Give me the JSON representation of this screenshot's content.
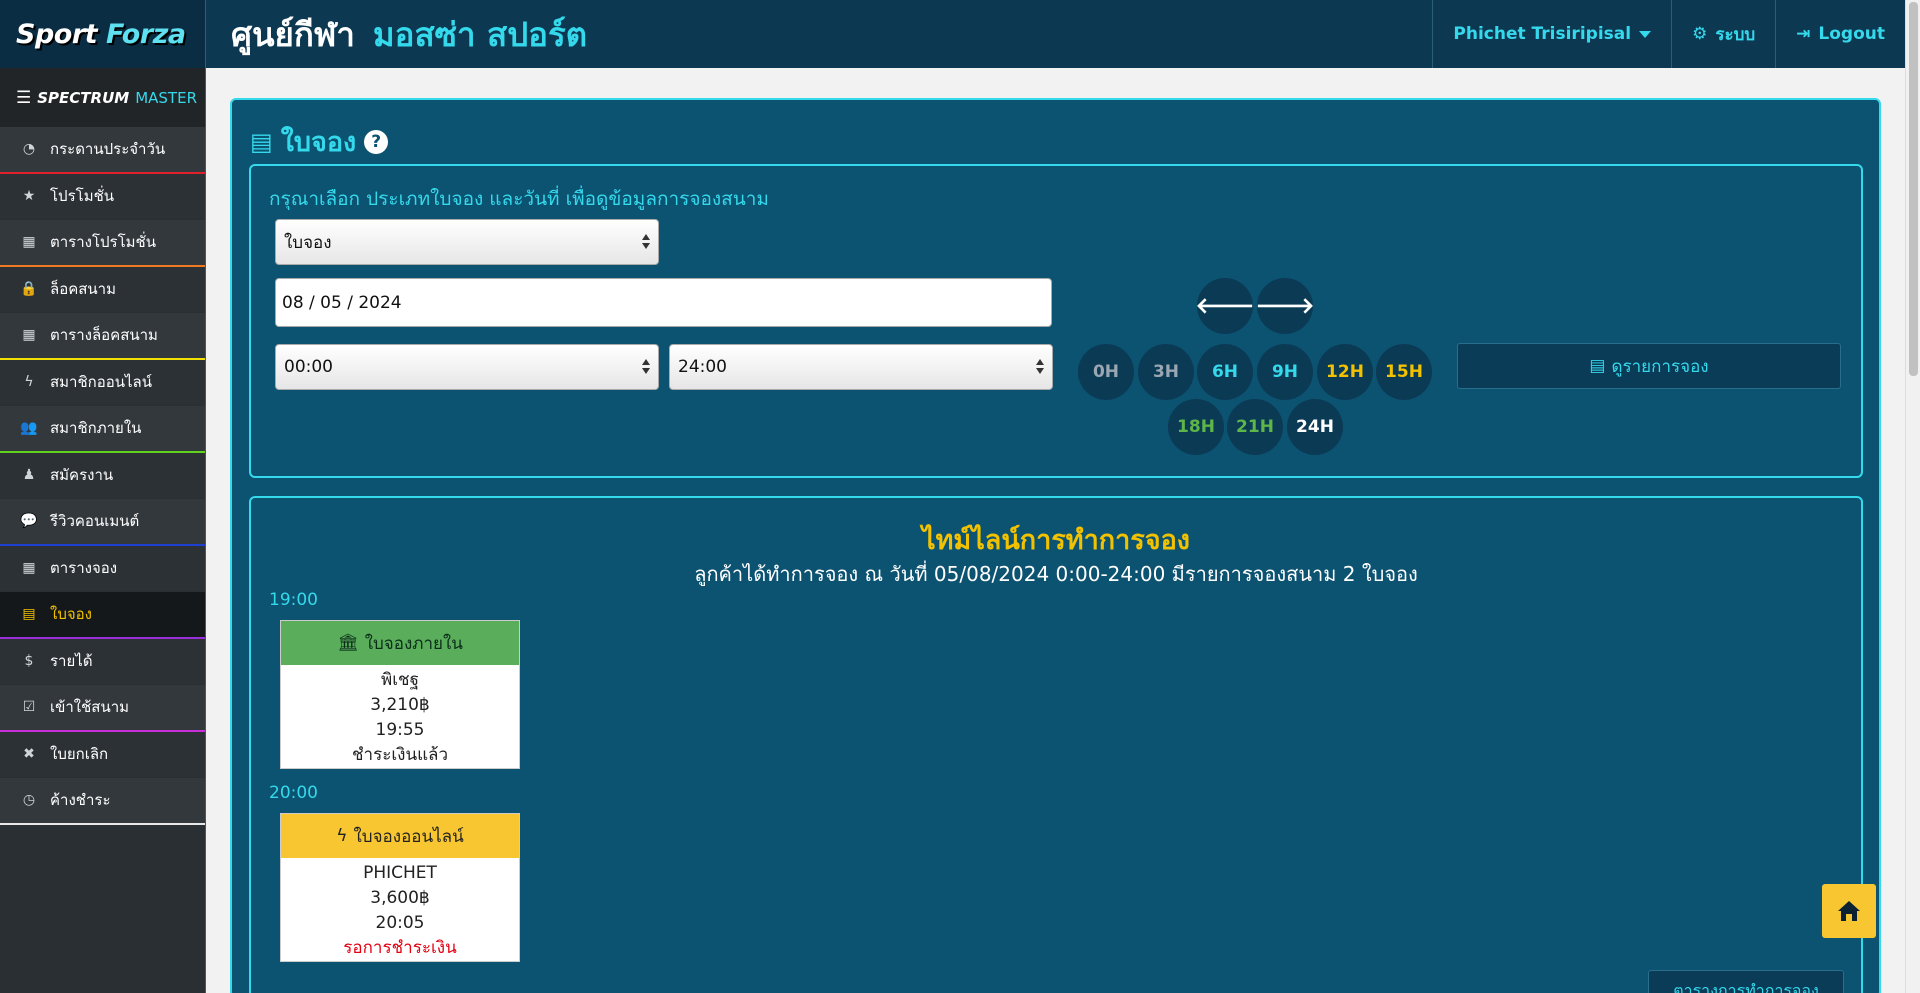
{
  "header": {
    "brand_sport": "Sport",
    "brand_forza": "Forza",
    "center_label": "ศูนย์กีฬา",
    "club_name": "มอสซ่า สปอร์ต",
    "user_name": "Phichet Trisiripisal",
    "system_label": "ระบบ",
    "logout_label": "Logout"
  },
  "sidebar": {
    "head_a": "SPECTRUM",
    "head_b": "MASTER",
    "items": [
      {
        "label": "กระดานประจำวัน",
        "icon": "dashboard-icon",
        "glyph": "◔",
        "divider": "#e0202a"
      },
      {
        "label": "โปรโมชั่น",
        "icon": "star-icon",
        "glyph": "★",
        "divider": ""
      },
      {
        "label": "ตารางโปรโมชั่น",
        "icon": "table-icon",
        "glyph": "▦",
        "divider": "#f07a22"
      },
      {
        "label": "ล็อคสนาม",
        "icon": "lock-icon",
        "glyph": "🔒",
        "divider": ""
      },
      {
        "label": "ตารางล็อคสนาม",
        "icon": "table-icon",
        "glyph": "▦",
        "divider": "#f2e000"
      },
      {
        "label": "สมาชิกออนไลน์",
        "icon": "bolt-icon",
        "glyph": "ϟ",
        "divider": ""
      },
      {
        "label": "สมาชิกภายใน",
        "icon": "users-icon",
        "glyph": "👥",
        "divider": "#61d21e"
      },
      {
        "label": "สมัครงาน",
        "icon": "user-tie-icon",
        "glyph": "♟",
        "divider": ""
      },
      {
        "label": "รีวิวคอนเมนต์",
        "icon": "comment-icon",
        "glyph": "💬",
        "divider": "#1f3fd0"
      },
      {
        "label": "ตารางจอง",
        "icon": "table-icon",
        "glyph": "▦",
        "divider": ""
      },
      {
        "label": "ใบจอง",
        "icon": "book-icon",
        "glyph": "▤",
        "divider": "#9a2ed8",
        "active": true
      },
      {
        "label": "รายได้",
        "icon": "dollar-icon",
        "glyph": "$",
        "divider": ""
      },
      {
        "label": "เข้าใช้สนาม",
        "icon": "check-square-icon",
        "glyph": "☑",
        "divider": "#c82fd8"
      },
      {
        "label": "ใบยกเลิก",
        "icon": "close-icon",
        "glyph": "✖",
        "divider": ""
      },
      {
        "label": "ค้างชำระ",
        "icon": "clock-icon",
        "glyph": "◷",
        "divider": "#e8e8e8"
      }
    ]
  },
  "main": {
    "title": "ใบจอง",
    "help": "?",
    "filter_hint": "กรุณาเลือก ประเภทใบจอง และวันที่ เพื่อดูข้อมูลการจองสนาม",
    "type_value": "ใบจอง",
    "date_value": "08 / 05 / 2024",
    "start_time": "00:00",
    "end_time": "24:00",
    "view_button": "ดูรายการจอง",
    "hours": [
      "0H",
      "3H",
      "6H",
      "9H",
      "12H",
      "15H",
      "18H",
      "21H",
      "24H"
    ],
    "colors": {
      "accent": "#35d9ec",
      "warning": "#f2c200",
      "success": "#5eb548",
      "panel": "#0c5271"
    }
  },
  "timeline": {
    "title": "ไทม์ไลน์การทำการจอง",
    "subtitle": "ลูกค้าได้ทำการจอง ณ วันที่ 05/08/2024 0:00-24:00 มีรายการจองสนาม 2 ใบจอง",
    "groups": [
      {
        "time": "19:00",
        "card_type": "ใบจองภายใน",
        "name": "พิเชฐ",
        "amount": "3,210฿",
        "card_time": "19:55",
        "status": "ชำระเงินแล้ว"
      },
      {
        "time": "20:00",
        "card_type": "ใบจองออนไลน์",
        "name": "PHICHET",
        "amount": "3,600฿",
        "card_time": "20:05",
        "status": "รอการชำระเงิน"
      }
    ],
    "schedule_button": "ตารางการทำการจอง"
  }
}
